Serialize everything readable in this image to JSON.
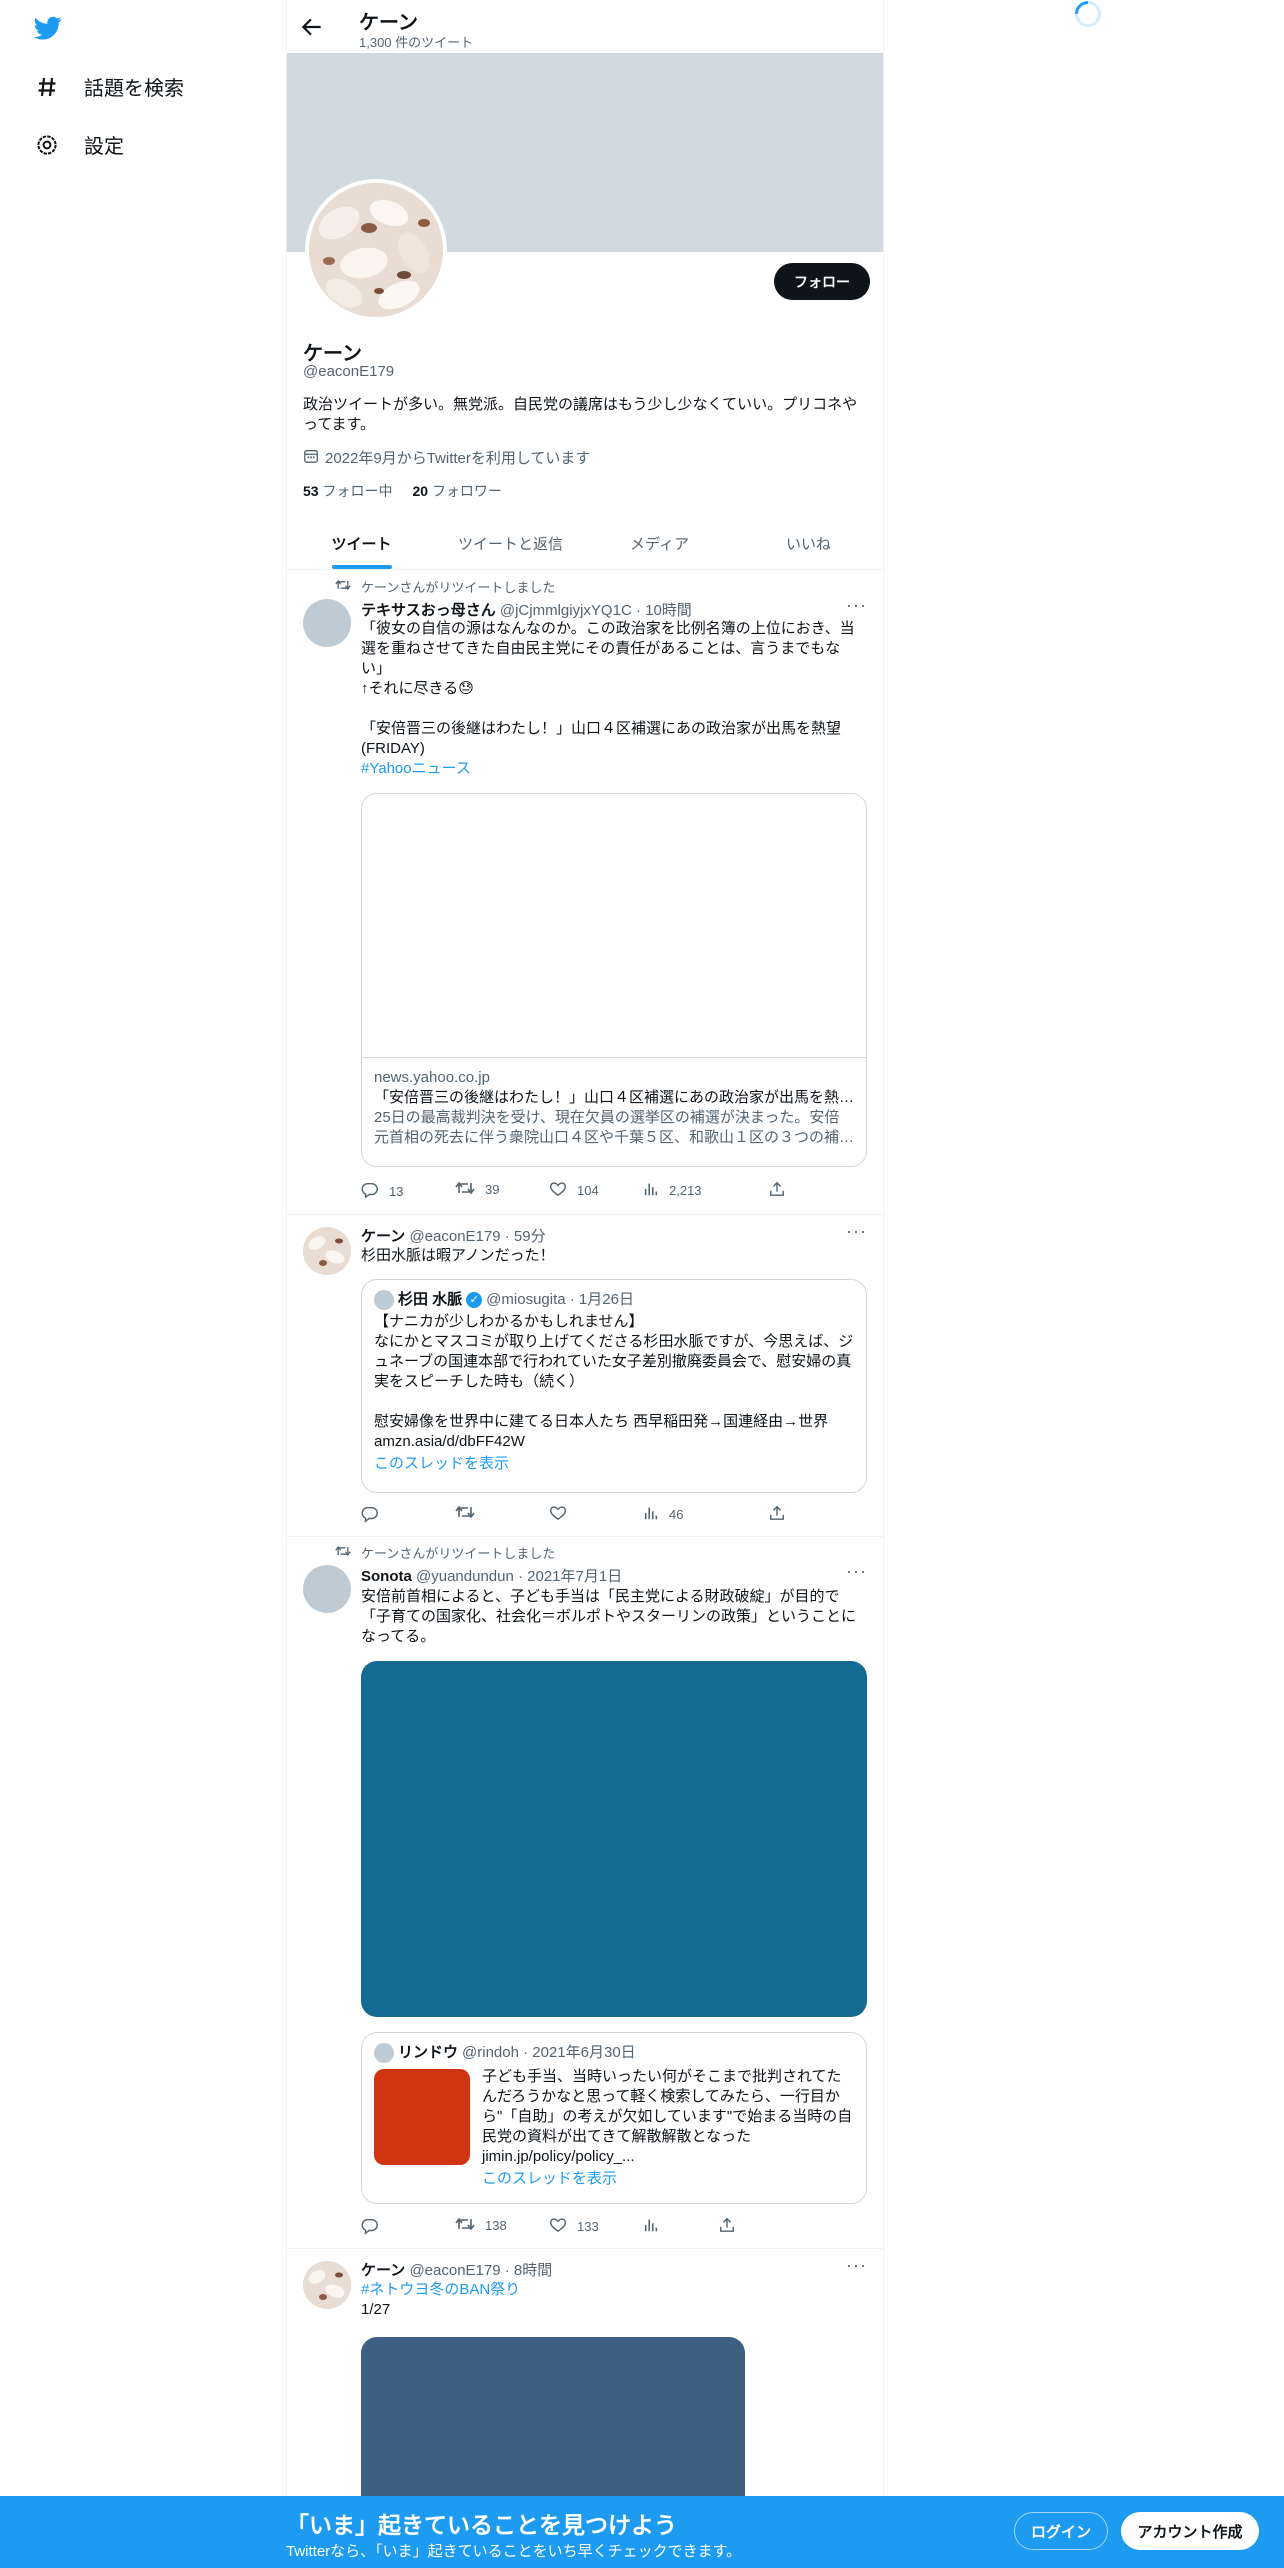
{
  "nav": {
    "explore_label": "話題を検索",
    "settings_label": "設定"
  },
  "header": {
    "title": "ケーン",
    "tweet_count": "1,300 件のツイート"
  },
  "profile": {
    "name": "ケーン",
    "handle": "@eaconE179",
    "bio": "政治ツイートが多い。無党派。自民党の議席はもう少し少なくていい。プリコネやってます。",
    "joined": "2022年9月からTwitterを利用しています",
    "following_count": "53",
    "following_label": "フォロー中",
    "followers_count": "20",
    "followers_label": "フォロワー",
    "follow_button": "フォロー"
  },
  "tabs": [
    "ツイート",
    "ツイートと返信",
    "メディア",
    "いいね"
  ],
  "tweets": [
    {
      "retweet_label": "ケーンさんがリツイートしました",
      "name": "テキサスおっ母さん",
      "handle_time": "@jCjmmlgiyjxYQ1C · 10時間",
      "text": "「彼女の自信の源はなんなのか。この政治家を比例名簿の上位におき、当選を重ねさせてきた自由民主党にその責任があることは、言うまでもない」\n↑それに尽きる😓\n\n「安倍晋三の後継はわたし！」山口４区補選にあの政治家が出馬を熱望(FRIDAY)",
      "hashtag": "#Yahooニュース",
      "card": {
        "domain": "news.yahoo.co.jp",
        "title": "「安倍晋三の後継はわたし！」山口４区補選にあの政治家が出馬を熱…",
        "desc": "25日の最高裁判決を受け、現在欠員の選挙区の補選が決まった。安倍元首相の死去に伴う衆院山口４区や千葉５区、和歌山１区の３つの補…"
      },
      "replies": "13",
      "retweets": "39",
      "likes": "104",
      "views": "2,213"
    },
    {
      "name": "ケーン",
      "handle_time": "@eaconE179 · 59分",
      "text": "杉田水脈は暇アノンだった！",
      "quote": {
        "name": "杉田 水脈",
        "handle_time": "@miosugita · 1月26日",
        "text": "【ナニカが少しわかるかもしれません】\nなにかとマスコミが取り上げてくださる杉田水脈ですが、今思えば、ジュネーブの国連本部で行われていた女子差別撤廃委員会で、慰安婦の真実をスピーチした時も（続く）\n\n慰安婦像を世界中に建てる日本人たち 西早稲田発→国連経由→世界\namzn.asia/d/dbFF42W",
        "show_thread": "このスレッドを表示"
      },
      "views": "46"
    },
    {
      "retweet_label": "ケーンさんがリツイートしました",
      "name": "Sonota",
      "handle_time": "@yuandundun · 2021年7月1日",
      "text": "安倍前首相によると、子ども手当は「民主党による財政破綻」が目的で「子育ての国家化、社会化＝ボルポトやスターリンの政策」ということになってる。",
      "media_color": "#136b93",
      "quote": {
        "name": "リンドウ",
        "handle_time": "@rindoh · 2021年6月30日",
        "text": "子ども手当、当時いったい何がそこまで批判されてたんだろうかなと思って軽く検索してみたら、一行目から\"「自助」の考えが欠如しています\"で始まる当時の自民党の資料が出てきて解散解散となった\njimin.jp/policy/policy_...",
        "show_thread": "このスレッドを表示",
        "thumb_color": "#d03412"
      },
      "retweets": "138",
      "likes": "133"
    },
    {
      "name": "ケーン",
      "handle_time": "@eaconE179 · 8時間",
      "hashtag": "#ネトウヨ冬のBAN祭り",
      "text": "1/27",
      "media_color": "#3d5f82"
    }
  ],
  "bottom_bar": {
    "title": "「いま」起きていることを見つけよう",
    "subtitle": "Twitterなら、「いま」起きていることをいち早くチェックできます。",
    "login": "ログイン",
    "signup": "アカウント作成"
  },
  "colors": {
    "accent": "#1d9bf0",
    "banner": "#cfd9de"
  }
}
